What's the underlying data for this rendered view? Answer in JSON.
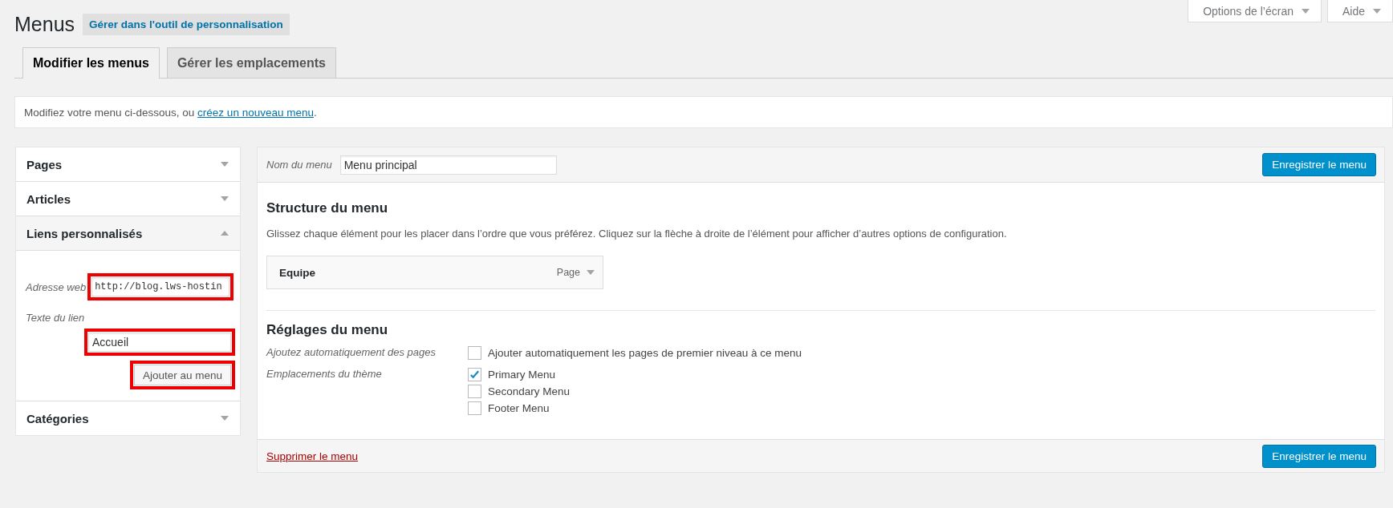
{
  "screen_meta": [
    {
      "label": "Options de l’écran"
    },
    {
      "label": "Aide"
    }
  ],
  "page": {
    "title": "Menus",
    "action": "Gérer dans l'outil de personnalisation"
  },
  "tabs": [
    {
      "label": "Modifier les menus",
      "selected": true
    },
    {
      "label": "Gérer les emplacements",
      "selected": false
    }
  ],
  "notice": {
    "text": "Modifiez votre menu ci-dessous, ou ",
    "link": "créez un nouveau menu",
    "after": "."
  },
  "sidebar": {
    "sections": [
      {
        "title": "Pages",
        "expanded": false
      },
      {
        "title": "Articles",
        "expanded": false
      },
      {
        "title": "Liens personnalisés",
        "expanded": true,
        "url_label": "Adresse web",
        "url_value": "http://blog.lws-hostin",
        "text_label": "Texte du lien",
        "text_value": "Accueil",
        "button": "Ajouter au menu",
        "highlighted": true
      },
      {
        "title": "Catégories",
        "expanded": false
      }
    ]
  },
  "editor": {
    "name_label": "Nom du menu",
    "name_value": "Menu principal",
    "save": "Enregistrer le menu",
    "structure_title": "Structure du menu",
    "structure_desc": "Glissez chaque élément pour les placer dans l’ordre que vous préférez. Cliquez sur la flèche à droite de l’élément pour afficher d’autres options de configuration.",
    "items": [
      {
        "title": "Equipe",
        "type": "Page"
      }
    ],
    "settings_title": "Réglages du menu",
    "settings": [
      {
        "label": "Ajoutez automatiquement des pages",
        "options": [
          {
            "label": "Ajouter automatiquement les pages de premier niveau à ce menu",
            "checked": false
          }
        ]
      },
      {
        "label": "Emplacements du thème",
        "options": [
          {
            "label": "Primary Menu",
            "checked": true
          },
          {
            "label": "Secondary Menu",
            "checked": false
          },
          {
            "label": "Footer Menu",
            "checked": false
          }
        ]
      }
    ],
    "delete": "Supprimer le menu",
    "save_bottom": "Enregistrer le menu"
  }
}
